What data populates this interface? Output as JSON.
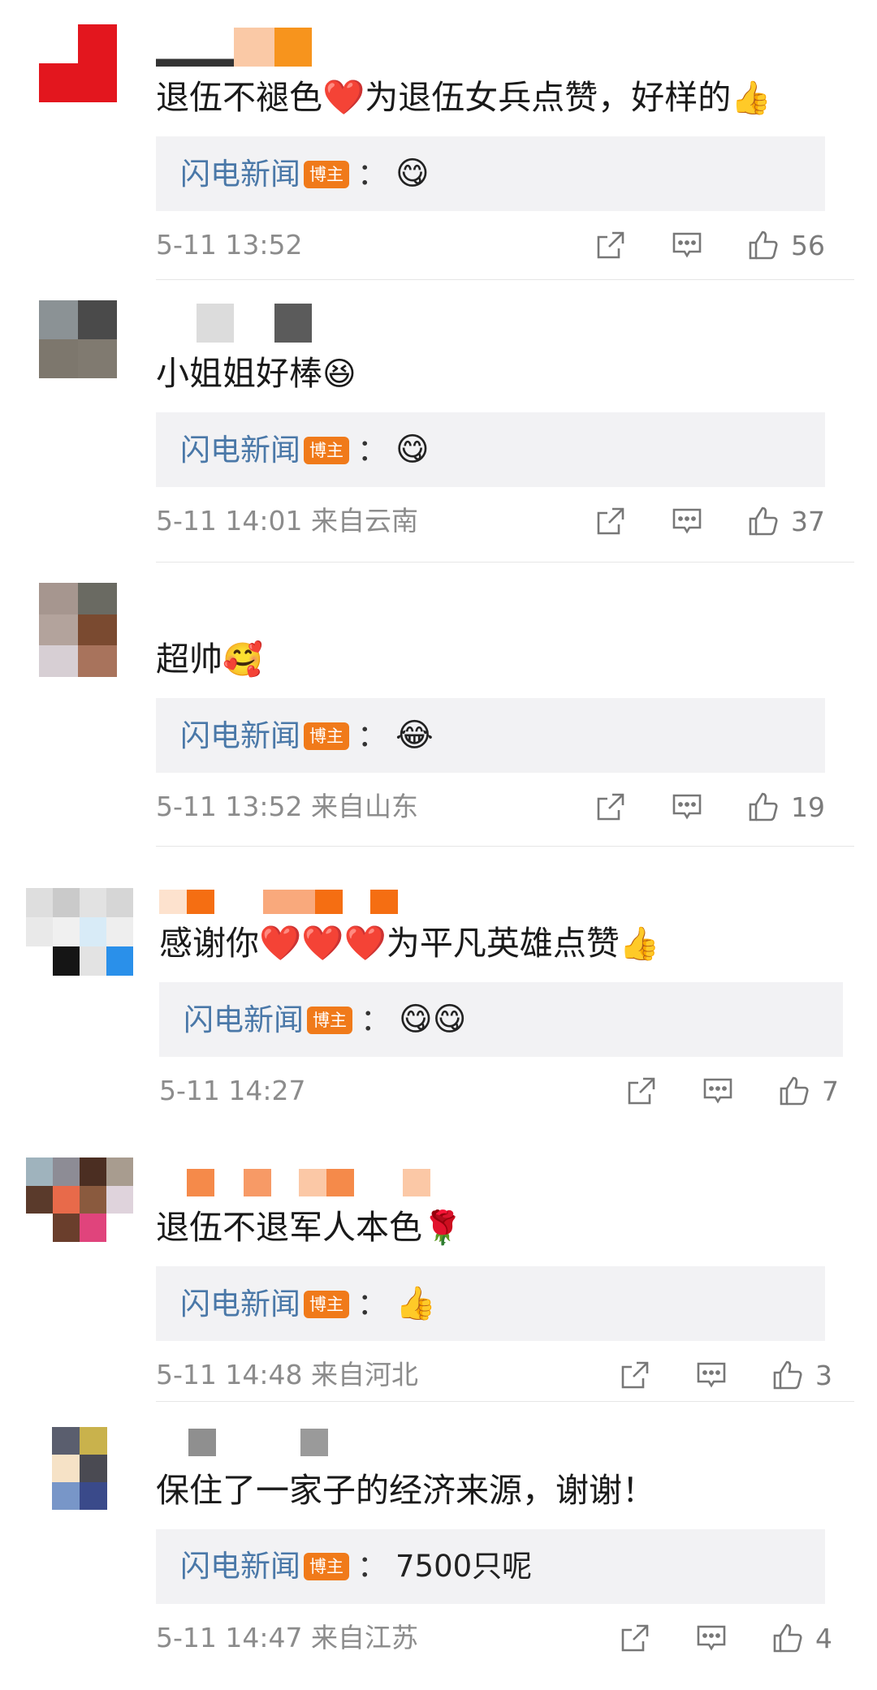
{
  "comments": [
    {
      "text_before": "退伍不褪色",
      "emoji1": "❤️",
      "text_after": "为退伍女兵点赞，好样的",
      "emoji2": "👍",
      "reply_author": "闪电新闻",
      "badge": "博主",
      "reply_colon": "：",
      "reply_text": "😋",
      "time": "5-11 13:52",
      "location": "",
      "likes": "56"
    },
    {
      "text_before": "小姐姐好棒",
      "emoji1": "😆",
      "text_after": "",
      "emoji2": "",
      "reply_author": "闪电新闻",
      "badge": "博主",
      "reply_colon": "：",
      "reply_text": "😋",
      "time": "5-11 14:01",
      "location": "来自云南",
      "likes": "37"
    },
    {
      "text_before": "超帅",
      "emoji1": "🥰",
      "text_after": "",
      "emoji2": "",
      "reply_author": "闪电新闻",
      "badge": "博主",
      "reply_colon": "：",
      "reply_text": "😂",
      "time": "5-11 13:52",
      "location": "来自山东",
      "likes": "19"
    },
    {
      "text_before": "感谢你",
      "emoji1": "❤️❤️❤️",
      "text_after": "为平凡英雄点赞",
      "emoji2": "👍",
      "reply_author": "闪电新闻",
      "badge": "博主",
      "reply_colon": "：",
      "reply_text": "😋😋",
      "time": "5-11 14:27",
      "location": "",
      "likes": "7"
    },
    {
      "text_before": "退伍不退军人本色",
      "emoji1": "🌹",
      "text_after": "",
      "emoji2": "",
      "reply_author": "闪电新闻",
      "badge": "博主",
      "reply_colon": "：",
      "reply_text": "👍",
      "time": "5-11 14:48",
      "location": "来自河北",
      "likes": "3"
    },
    {
      "text_before": "保住了一家子的经济来源，谢谢！",
      "emoji1": "",
      "text_after": "",
      "emoji2": "",
      "reply_author": "闪电新闻",
      "badge": "博主",
      "reply_colon": "：",
      "reply_text": "7500只呢",
      "time": "5-11 14:47",
      "location": "来自江苏",
      "likes": "4"
    }
  ],
  "colors": {
    "accent_author": "#4a78a8",
    "badge": "#f07a1a",
    "heart": "#e7262c",
    "meta": "#8c8c8c",
    "reply_bg": "#f2f2f4"
  },
  "icons": {
    "share": "share-icon",
    "comment": "comment-icon",
    "like": "thumbs-up-icon"
  }
}
